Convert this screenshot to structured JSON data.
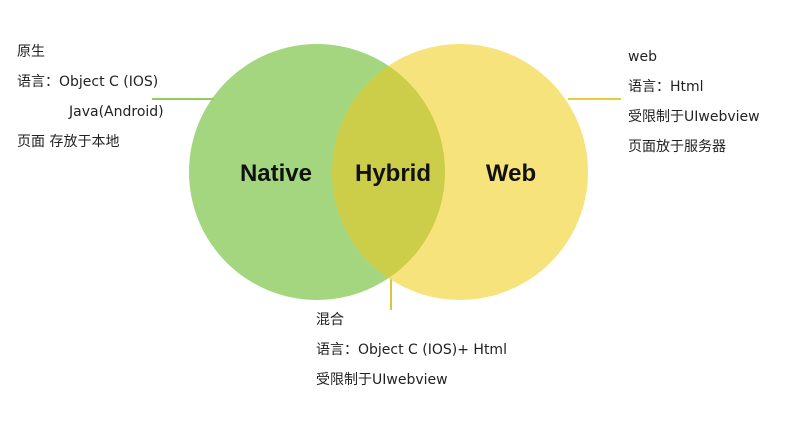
{
  "diagram": {
    "circles": [
      {
        "id": "native",
        "label": "Native",
        "color": "#8fcd61"
      },
      {
        "id": "web",
        "label": "Web",
        "color": "#f4dd5e"
      }
    ],
    "overlap": {
      "label": "Hybrid",
      "color": "#cccd49"
    },
    "connector_colors": {
      "native": "#8fcd61",
      "web": "#e8cd3a",
      "hybrid": "#d8c63c"
    }
  },
  "notes": {
    "native": {
      "title": "原生",
      "language_line": "语言：Object C (IOS)",
      "language_line2": "Java(Android)",
      "page_line": "页面  存放于本地"
    },
    "web": {
      "title": "web",
      "language_line": "语言：Html",
      "limit_line": "受限制于UIwebview",
      "page_line": "页面放于服务器"
    },
    "hybrid": {
      "title": "混合",
      "language_line": "语言：Object C (IOS)+ Html",
      "limit_line": "受限制于UIwebview"
    }
  }
}
